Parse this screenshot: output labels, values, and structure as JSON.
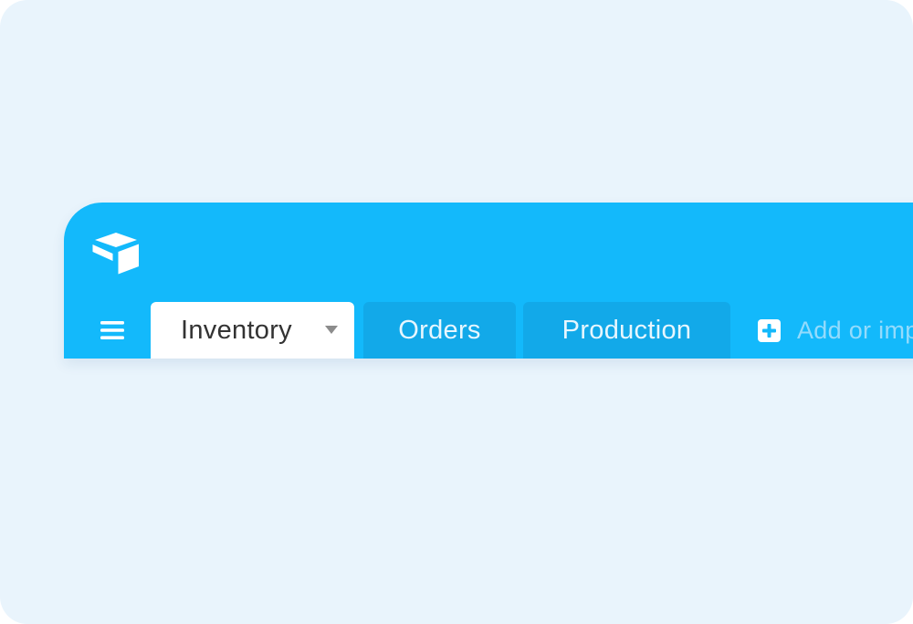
{
  "tabs": [
    {
      "label": "Inventory",
      "active": true
    },
    {
      "label": "Orders",
      "active": false
    },
    {
      "label": "Production",
      "active": false
    }
  ],
  "add_or_import": {
    "label": "Add or imp"
  },
  "icons": {
    "logo": "airtable-logo-icon",
    "menu": "hamburger-menu-icon",
    "tab_dropdown": "caret-down-icon",
    "add": "plus-square-icon"
  },
  "colors": {
    "background": "#e9f4fc",
    "bar": "#13b9fb",
    "inactive_tab": "#12a9e9",
    "active_tab": "#ffffff",
    "active_tab_text": "#333333",
    "muted_label": "#94dbfc"
  }
}
